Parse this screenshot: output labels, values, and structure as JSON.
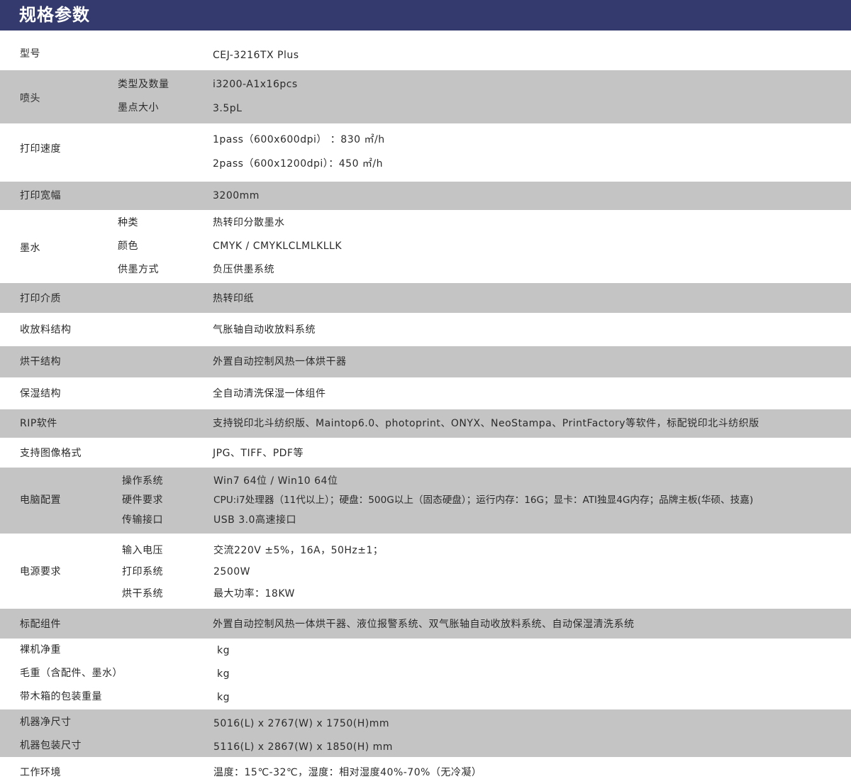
{
  "header": {
    "title": "规格参数"
  },
  "rows": [
    {
      "label": "型号",
      "value": "CEJ-3216TX Plus"
    },
    {
      "label": "喷头",
      "subs": [
        {
          "label": "类型及数量",
          "value": "i3200-A1x16pcs"
        },
        {
          "label": "墨点大小",
          "value": "3.5pL"
        }
      ]
    },
    {
      "label": "打印速度",
      "lines": [
        "1pass（600x600dpi）  ：830 ㎡/h",
        "2pass（600x1200dpi）：450 ㎡/h"
      ]
    },
    {
      "label": "打印宽幅",
      "value": "3200mm"
    },
    {
      "label": "墨水",
      "subs": [
        {
          "label": "种类",
          "value": "热转印分散墨水"
        },
        {
          "label": "颜色",
          "value": "CMYK  /  CMYKLCLMLKLLK"
        },
        {
          "label": "供墨方式",
          "value": "负压供墨系统"
        }
      ]
    },
    {
      "label": "打印介质",
      "value": "热转印纸"
    },
    {
      "label": "收放料结构",
      "value": "气胀轴自动收放料系统"
    },
    {
      "label": "烘干结构",
      "value": "外置自动控制风热一体烘干器"
    },
    {
      "label": "保湿结构",
      "value": "全自动清洗保湿一体组件"
    },
    {
      "label": "RIP软件",
      "value": "支持锐印北斗纺织版、Maintop6.0、photoprint、ONYX、NeoStampa、PrintFactory等软件，标配锐印北斗纺织版"
    },
    {
      "label": "支持图像格式",
      "value": "JPG、TIFF、PDF等"
    },
    {
      "label": "电脑配置",
      "subs": [
        {
          "label": "操作系统",
          "value": "Win7 64位 / Win10 64位"
        },
        {
          "label": "硬件要求",
          "value": "CPU:i7处理器（11代以上）；硬盘：500G以上（固态硬盘）；运行内存：16G；显卡：ATI独显4G内存；品牌主板(华硕、技嘉)"
        },
        {
          "label": "传输接口",
          "value": "USB 3.0高速接口"
        }
      ]
    },
    {
      "label": "电源要求",
      "subs": [
        {
          "label": "输入电压",
          "value": "交流220V ±5%，16A，50Hz±1；"
        },
        {
          "label": "打印系统",
          "value": "2500W"
        },
        {
          "label": "烘干系统",
          "value": "最大功率：18KW"
        }
      ]
    },
    {
      "label": "标配组件",
      "value": "外置自动控制风热一体烘干器、液位报警系统、双气胀轴自动收放料系统、自动保湿清洗系统"
    },
    {
      "labels": [
        {
          "label": "裸机净重",
          "value": "kg"
        },
        {
          "label": "毛重（含配件、墨水）",
          "value": "kg"
        },
        {
          "label": "带木箱的包装重量",
          "value": "kg"
        }
      ]
    },
    {
      "labels": [
        {
          "label": "机器净尺寸",
          "value": "5016(L) x 2767(W) x 1750(H)mm"
        },
        {
          "label": "机器包装尺寸",
          "value": "5116(L) x 2867(W) x 1850(H) mm"
        }
      ]
    },
    {
      "label": "工作环境",
      "value": "温度：15℃-32℃，湿度：相对湿度40%-70%（无冷凝）"
    }
  ]
}
